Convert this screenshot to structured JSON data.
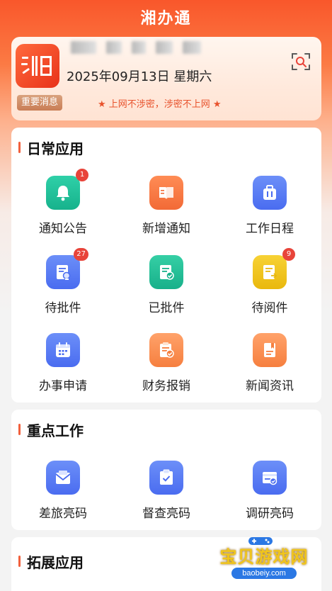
{
  "app_title": "湘办通",
  "header": {
    "logo_text": "湘",
    "date": "2025年09月13日 星期六",
    "message_badge": "重要消息",
    "slogan": "★ 上网不涉密，涉密不上网 ★"
  },
  "sections": {
    "daily": {
      "title": "日常应用",
      "items": [
        {
          "label": "通知公告",
          "icon": "bell-icon",
          "badge": "1"
        },
        {
          "label": "新增通知",
          "icon": "notice-book-icon"
        },
        {
          "label": "工作日程",
          "icon": "briefcase-icon"
        },
        {
          "label": "待批件",
          "icon": "pending-approval-icon",
          "badge": "27"
        },
        {
          "label": "已批件",
          "icon": "approved-doc-icon"
        },
        {
          "label": "待阅件",
          "icon": "to-read-doc-icon",
          "badge": "9"
        },
        {
          "label": "办事申请",
          "icon": "calendar-icon"
        },
        {
          "label": "财务报销",
          "icon": "finance-doc-icon"
        },
        {
          "label": "新闻资讯",
          "icon": "news-icon"
        }
      ]
    },
    "key_work": {
      "title": "重点工作",
      "items": [
        {
          "label": "差旅亮码",
          "icon": "envelope-icon"
        },
        {
          "label": "督查亮码",
          "icon": "clipboard-check-icon"
        },
        {
          "label": "调研亮码",
          "icon": "research-card-icon"
        }
      ]
    },
    "extended": {
      "title": "拓展应用"
    }
  },
  "watermark_site": {
    "cn": "宝贝游戏网",
    "en": "baobeiy.com"
  },
  "colors": {
    "accent": "#f1603c",
    "badge_red": "#e8443a"
  }
}
